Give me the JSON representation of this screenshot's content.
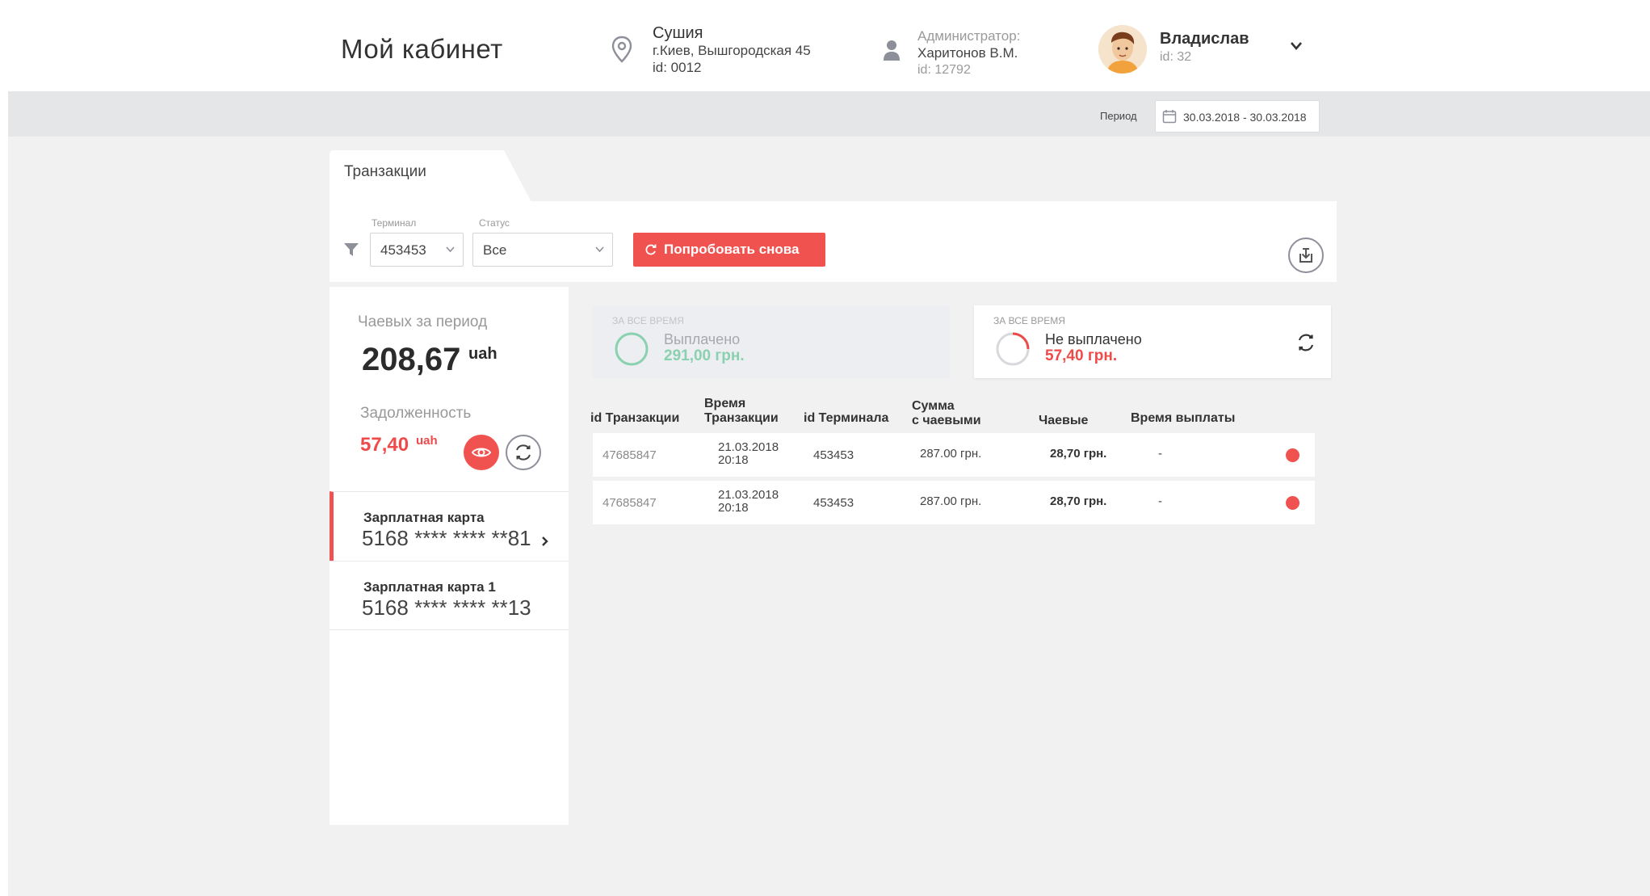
{
  "header": {
    "title": "Мой кабинет",
    "location": {
      "name": "Сушия",
      "address": "г.Киев, Вышгородская 45",
      "id": "id: 0012"
    },
    "admin": {
      "role": "Администратор:",
      "name": "Харитонов В.М.",
      "id": "id: 12792"
    },
    "user": {
      "name": "Владислав",
      "id": "id: 32"
    }
  },
  "period": {
    "label": "Период",
    "value": "30.03.2018 - 30.03.2018"
  },
  "tab": {
    "label": "Транзакции"
  },
  "filters": {
    "terminal": {
      "label": "Терминал",
      "value": "453453"
    },
    "status": {
      "label": "Статус",
      "value": "Все"
    },
    "retry_label": "Попробовать снова"
  },
  "left": {
    "tips_label": "Чаевых за период",
    "tips_value": "208,67",
    "tips_unit": "uah",
    "debt_label": "Задолженность",
    "debt_value": "57,40",
    "debt_unit": "uah",
    "cards": [
      {
        "name": "Зарплатная карта",
        "number": "5168 **** **** **81"
      },
      {
        "name": "Зарплатная карта 1",
        "number": "5168 **** **** **13"
      }
    ]
  },
  "summary": {
    "paid": {
      "caption": "ЗА ВСЕ ВРЕМЯ",
      "title": "Выплачено",
      "amount": "291,00 грн."
    },
    "unpaid": {
      "caption": "ЗА ВСЕ ВРЕМЯ",
      "title": "Не выплачено",
      "amount": "57,40 грн."
    }
  },
  "table": {
    "headers": {
      "tx_id": "id Транзакции",
      "tx_time_1": "Время",
      "tx_time_2": "Транзакции",
      "terminal_id": "id Терминала",
      "sum_1": "Сумма",
      "sum_2": "с чаевыми",
      "tips": "Чаевые",
      "payout_time": "Время выплаты"
    },
    "rows": [
      {
        "tx_id": "47685847",
        "date": "21.03.2018",
        "time": "20:18",
        "terminal": "453453",
        "sum": "287.00 грн.",
        "tips": "28,70 грн.",
        "payout": "-"
      },
      {
        "tx_id": "47685847",
        "date": "21.03.2018",
        "time": "20:18",
        "terminal": "453453",
        "sum": "287.00 грн.",
        "tips": "28,70 грн.",
        "payout": "-"
      }
    ]
  },
  "colors": {
    "accent": "#f0524f",
    "paid": "#8ad1b0",
    "unpaid": "#ef4a4a"
  }
}
